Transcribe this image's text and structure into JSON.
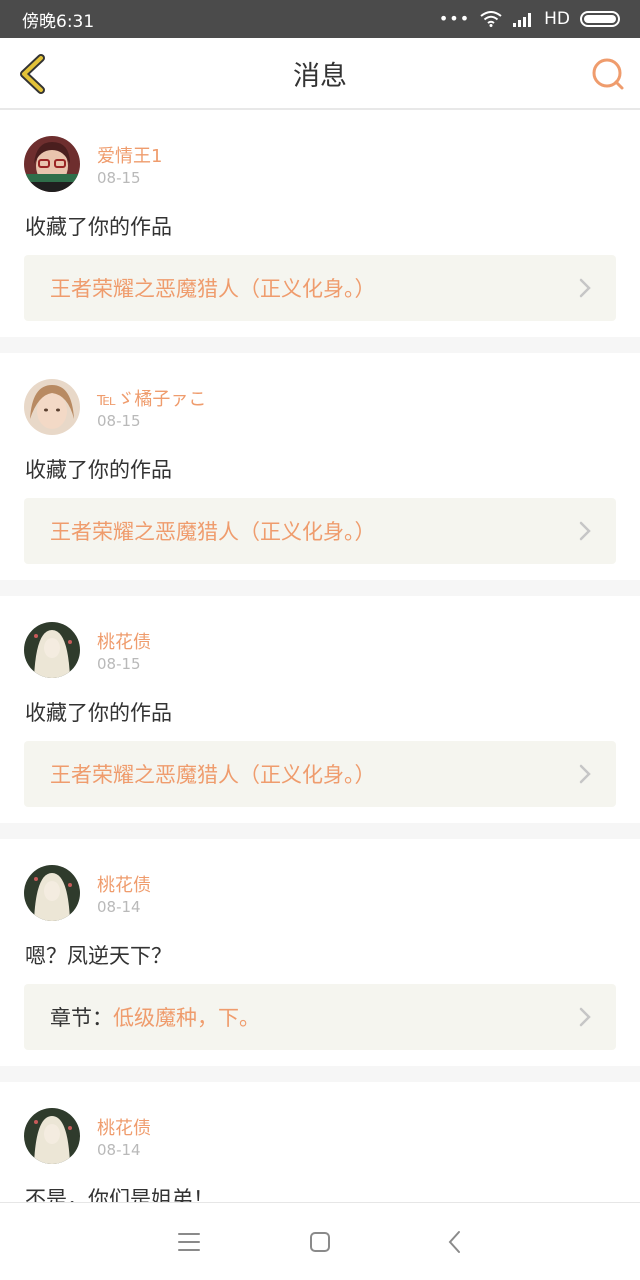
{
  "status_bar": {
    "time": "傍晚6:31",
    "network": "HD",
    "icons": [
      "dots-icon",
      "wifi-icon",
      "signal-icon",
      "battery-icon"
    ]
  },
  "header": {
    "title": "消息",
    "back_icon": "chevron-left-icon",
    "search_icon": "search-icon"
  },
  "colors": {
    "accent": "#ef9c6d",
    "back_arrow": "#e2c238",
    "ref_bg": "#f5f5ef",
    "separator": "#f6f6f6"
  },
  "messages": [
    {
      "user": "爱情王1",
      "date": "08-15",
      "text": "收藏了你的作品",
      "ref_label": "",
      "ref_title": "王者荣耀之恶魔猎人（正义化身。）"
    },
    {
      "user": "℡ゞ橘子ァこ",
      "date": "08-15",
      "text": "收藏了你的作品",
      "ref_label": "",
      "ref_title": "王者荣耀之恶魔猎人（正义化身。）"
    },
    {
      "user": "桃花债",
      "date": "08-15",
      "text": "收藏了你的作品",
      "ref_label": "",
      "ref_title": "王者荣耀之恶魔猎人（正义化身。）"
    },
    {
      "user": "桃花债",
      "date": "08-14",
      "text": "嗯？凤逆天下？",
      "ref_label": "章节：",
      "ref_title": "低级魔种，下。"
    },
    {
      "user": "桃花债",
      "date": "08-14",
      "text": "不是，你们是姐弟！"
    }
  ],
  "nav": {
    "icons": [
      "menu-icon",
      "home-icon",
      "back-icon"
    ]
  }
}
